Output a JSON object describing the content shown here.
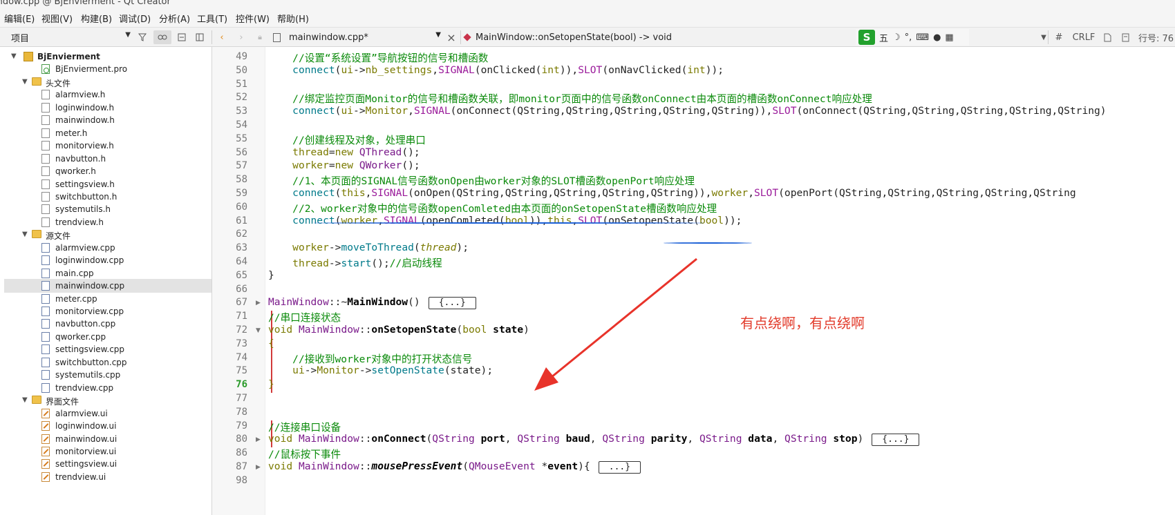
{
  "window": {
    "title": "indow.cpp @ BjEnvierment - Qt Creator"
  },
  "menu": [
    "编辑(E)",
    "视图(V)",
    "构建(B)",
    "调试(D)",
    "分析(A)",
    "工具(T)",
    "控件(W)",
    "帮助(H)"
  ],
  "toolbar": {
    "project_combo": "项目",
    "file_combo": "mainwindow.cpp*",
    "function_combo": "MainWindow::onSetopenState(bool) -> void",
    "ime_glyph": "五",
    "line_ending": "CRLF",
    "hash": "#",
    "position": "行号: 76"
  },
  "tree": [
    {
      "label": "BjEnvierment",
      "kind": "project",
      "indent": 0,
      "expanded": true,
      "bold": true
    },
    {
      "label": "BjEnvierment.pro",
      "kind": "pro",
      "indent": 2
    },
    {
      "label": "头文件",
      "kind": "folder",
      "indent": 1,
      "expanded": true
    },
    {
      "label": "alarmview.h",
      "kind": "h",
      "indent": 2
    },
    {
      "label": "loginwindow.h",
      "kind": "h",
      "indent": 2
    },
    {
      "label": "mainwindow.h",
      "kind": "h",
      "indent": 2
    },
    {
      "label": "meter.h",
      "kind": "h",
      "indent": 2
    },
    {
      "label": "monitorview.h",
      "kind": "h",
      "indent": 2
    },
    {
      "label": "navbutton.h",
      "kind": "h",
      "indent": 2
    },
    {
      "label": "qworker.h",
      "kind": "h",
      "indent": 2
    },
    {
      "label": "settingsview.h",
      "kind": "h",
      "indent": 2
    },
    {
      "label": "switchbutton.h",
      "kind": "h",
      "indent": 2
    },
    {
      "label": "systemutils.h",
      "kind": "h",
      "indent": 2
    },
    {
      "label": "trendview.h",
      "kind": "h",
      "indent": 2
    },
    {
      "label": "源文件",
      "kind": "folder",
      "indent": 1,
      "expanded": true
    },
    {
      "label": "alarmview.cpp",
      "kind": "cpp",
      "indent": 2
    },
    {
      "label": "loginwindow.cpp",
      "kind": "cpp",
      "indent": 2
    },
    {
      "label": "main.cpp",
      "kind": "cpp",
      "indent": 2
    },
    {
      "label": "mainwindow.cpp",
      "kind": "cpp",
      "indent": 2,
      "selected": true
    },
    {
      "label": "meter.cpp",
      "kind": "cpp",
      "indent": 2
    },
    {
      "label": "monitorview.cpp",
      "kind": "cpp",
      "indent": 2
    },
    {
      "label": "navbutton.cpp",
      "kind": "cpp",
      "indent": 2
    },
    {
      "label": "qworker.cpp",
      "kind": "cpp",
      "indent": 2
    },
    {
      "label": "settingsview.cpp",
      "kind": "cpp",
      "indent": 2
    },
    {
      "label": "switchbutton.cpp",
      "kind": "cpp",
      "indent": 2
    },
    {
      "label": "systemutils.cpp",
      "kind": "cpp",
      "indent": 2
    },
    {
      "label": "trendview.cpp",
      "kind": "cpp",
      "indent": 2
    },
    {
      "label": "界面文件",
      "kind": "uifolder",
      "indent": 1,
      "expanded": true
    },
    {
      "label": "alarmview.ui",
      "kind": "ui",
      "indent": 2
    },
    {
      "label": "loginwindow.ui",
      "kind": "ui",
      "indent": 2
    },
    {
      "label": "mainwindow.ui",
      "kind": "ui",
      "indent": 2
    },
    {
      "label": "monitorview.ui",
      "kind": "ui",
      "indent": 2
    },
    {
      "label": "settingsview.ui",
      "kind": "ui",
      "indent": 2
    },
    {
      "label": "trendview.ui",
      "kind": "ui",
      "indent": 2
    }
  ],
  "code_lines": [
    {
      "n": "49",
      "segs": [
        [
          "    ",
          ""
        ],
        [
          "//设置“系统设置”导航按钮的信号和槽函数",
          "cm"
        ]
      ]
    },
    {
      "n": "50",
      "segs": [
        [
          "    ",
          ""
        ],
        [
          "connect",
          "fn"
        ],
        [
          "(",
          ""
        ],
        [
          "ui",
          "kw"
        ],
        [
          "->",
          ""
        ],
        [
          "nb_settings",
          "kw"
        ],
        [
          ",",
          ""
        ],
        [
          "SIGNAL",
          "mc"
        ],
        [
          "(onClicked(",
          ""
        ],
        [
          "int",
          "kw"
        ],
        [
          "))",
          ""
        ],
        [
          ",",
          ""
        ],
        [
          "SLOT",
          "mc"
        ],
        [
          "(onNavClicked(",
          ""
        ],
        [
          "int",
          "kw"
        ],
        [
          "));",
          ""
        ]
      ]
    },
    {
      "n": "51",
      "segs": []
    },
    {
      "n": "52",
      "segs": [
        [
          "    ",
          ""
        ],
        [
          "//绑定监控页面Monitor的信号和槽函数关联，即monitor页面中的信号函数onConnect由本页面的槽函数onConnect响应处理",
          "cm"
        ]
      ]
    },
    {
      "n": "53",
      "segs": [
        [
          "    ",
          ""
        ],
        [
          "connect",
          "fn"
        ],
        [
          "(",
          ""
        ],
        [
          "ui",
          "kw"
        ],
        [
          "->",
          ""
        ],
        [
          "Monitor",
          "kw"
        ],
        [
          ",",
          ""
        ],
        [
          "SIGNAL",
          "mc"
        ],
        [
          "(onConnect(QString,QString,QString,QString,QString))",
          ""
        ],
        [
          ",",
          ""
        ],
        [
          "SLOT",
          "mc"
        ],
        [
          "(onConnect(QString,QString,QString,QString,QString)",
          ""
        ]
      ]
    },
    {
      "n": "54",
      "segs": []
    },
    {
      "n": "55",
      "segs": [
        [
          "    ",
          ""
        ],
        [
          "//创建线程及对象，处理串口",
          "cm"
        ]
      ]
    },
    {
      "n": "56",
      "segs": [
        [
          "    ",
          ""
        ],
        [
          "thread",
          "kw"
        ],
        [
          "=",
          ""
        ],
        [
          "new",
          "kw"
        ],
        [
          " ",
          ""
        ],
        [
          "QThread",
          "ty"
        ],
        [
          "();",
          ""
        ]
      ]
    },
    {
      "n": "57",
      "segs": [
        [
          "    ",
          ""
        ],
        [
          "worker",
          "kw"
        ],
        [
          "=",
          ""
        ],
        [
          "new",
          "kw"
        ],
        [
          " ",
          ""
        ],
        [
          "QWorker",
          "ty"
        ],
        [
          "();",
          ""
        ]
      ]
    },
    {
      "n": "58",
      "segs": [
        [
          "    ",
          ""
        ],
        [
          "//1、本页面的SIGNAL信号函数onOpen由worker对象的SLOT槽函数openPort响应处理",
          "cm"
        ]
      ]
    },
    {
      "n": "59",
      "segs": [
        [
          "    ",
          ""
        ],
        [
          "connect",
          "fn"
        ],
        [
          "(",
          ""
        ],
        [
          "this",
          "kw"
        ],
        [
          ",",
          ""
        ],
        [
          "SIGNAL",
          "mc"
        ],
        [
          "(onOpen(QString,QString,QString,QString,QString))",
          ""
        ],
        [
          ",",
          ""
        ],
        [
          "worker",
          "kw"
        ],
        [
          ",",
          ""
        ],
        [
          "SLOT",
          "mc"
        ],
        [
          "(openPort(QString,QString,QString,QString,QString",
          ""
        ]
      ]
    },
    {
      "n": "60",
      "segs": [
        [
          "    ",
          ""
        ],
        [
          "//2、worker对象中的信号函数openComleted由本页面的onSetopenState槽函数响应处理",
          "cm"
        ]
      ]
    },
    {
      "n": "61",
      "segs": [
        [
          "    ",
          ""
        ],
        [
          "connect",
          "fn"
        ],
        [
          "(",
          ""
        ],
        [
          "worker",
          "kw"
        ],
        [
          ",",
          ""
        ],
        [
          "SIGNAL",
          "mc"
        ],
        [
          "(openComleted(",
          ""
        ],
        [
          "bool",
          "kw"
        ],
        [
          "))",
          ""
        ],
        [
          ",",
          ""
        ],
        [
          "this",
          "kw"
        ],
        [
          ",",
          ""
        ],
        [
          "SLOT",
          "mc"
        ],
        [
          "(onSetopenState(",
          ""
        ],
        [
          "bool",
          "kw"
        ],
        [
          "));",
          ""
        ]
      ]
    },
    {
      "n": "62",
      "segs": []
    },
    {
      "n": "63",
      "segs": [
        [
          "    ",
          ""
        ],
        [
          "worker",
          "kw"
        ],
        [
          "->",
          ""
        ],
        [
          "moveToThread",
          "fn"
        ],
        [
          "(",
          ""
        ],
        [
          "thread",
          "kw it"
        ],
        [
          ");",
          ""
        ]
      ]
    },
    {
      "n": "64",
      "segs": [
        [
          "    ",
          ""
        ],
        [
          "thread",
          "kw"
        ],
        [
          "->",
          ""
        ],
        [
          "start",
          "fn"
        ],
        [
          "();",
          ""
        ],
        [
          "//启动线程",
          "cm"
        ]
      ]
    },
    {
      "n": "65",
      "segs": [
        [
          "}",
          ""
        ]
      ]
    },
    {
      "n": "66",
      "segs": []
    },
    {
      "n": "67",
      "segs": [
        [
          "MainWindow",
          "ty"
        ],
        [
          "::~",
          ""
        ],
        [
          "MainWindow",
          "pm fn"
        ],
        [
          "()",
          ""
        ]
      ],
      "fold": "▶",
      "box": "{...}"
    },
    {
      "n": "71",
      "segs": [
        [
          "//串口连接状态",
          "cm"
        ]
      ]
    },
    {
      "n": "72",
      "segs": [
        [
          "void",
          "kw"
        ],
        [
          " ",
          ""
        ],
        [
          "MainWindow",
          "ty"
        ],
        [
          "::",
          ""
        ],
        [
          "onSetopenState",
          "pm fn"
        ],
        [
          "(",
          ""
        ],
        [
          "bool",
          "kw"
        ],
        [
          " ",
          ""
        ],
        [
          "state",
          "pm"
        ],
        [
          ")",
          ""
        ]
      ],
      "fold": "▼"
    },
    {
      "n": "73",
      "segs": [
        [
          "{",
          "kw"
        ]
      ]
    },
    {
      "n": "74",
      "segs": [
        [
          "    ",
          ""
        ],
        [
          "//接收到worker对象中的打开状态信号",
          "cm"
        ]
      ]
    },
    {
      "n": "75",
      "segs": [
        [
          "    ",
          ""
        ],
        [
          "ui",
          "kw"
        ],
        [
          "->",
          ""
        ],
        [
          "Monitor",
          "kw"
        ],
        [
          "->",
          ""
        ],
        [
          "setOpenState",
          "fn"
        ],
        [
          "(state);",
          ""
        ]
      ]
    },
    {
      "n": "76",
      "segs": [
        [
          "}",
          "kw"
        ]
      ],
      "current": true
    },
    {
      "n": "77",
      "segs": []
    },
    {
      "n": "78",
      "segs": []
    },
    {
      "n": "79",
      "segs": [
        [
          "//连接串口设备",
          "cm"
        ]
      ]
    },
    {
      "n": "80",
      "segs": [
        [
          "void",
          "kw"
        ],
        [
          " ",
          ""
        ],
        [
          "MainWindow",
          "ty"
        ],
        [
          "::",
          ""
        ],
        [
          "onConnect",
          "pm fn"
        ],
        [
          "(",
          ""
        ],
        [
          "QString",
          "ty"
        ],
        [
          " ",
          ""
        ],
        [
          "port",
          "pm"
        ],
        [
          ", ",
          ""
        ],
        [
          "QString",
          "ty"
        ],
        [
          " ",
          ""
        ],
        [
          "baud",
          "pm"
        ],
        [
          ", ",
          ""
        ],
        [
          "QString",
          "ty"
        ],
        [
          " ",
          ""
        ],
        [
          "parity",
          "pm"
        ],
        [
          ", ",
          ""
        ],
        [
          "QString",
          "ty"
        ],
        [
          " ",
          ""
        ],
        [
          "data",
          "pm"
        ],
        [
          ", ",
          ""
        ],
        [
          "QString",
          "ty"
        ],
        [
          " ",
          ""
        ],
        [
          "stop",
          "pm"
        ],
        [
          ")",
          ""
        ]
      ],
      "fold": "▶",
      "box": "{...}"
    },
    {
      "n": "86",
      "segs": [
        [
          "//鼠标按下事件",
          "cm"
        ]
      ]
    },
    {
      "n": "87",
      "segs": [
        [
          "void",
          "kw"
        ],
        [
          " ",
          ""
        ],
        [
          "MainWindow",
          "ty"
        ],
        [
          "::",
          ""
        ],
        [
          "mousePressEvent",
          "pm fn it"
        ],
        [
          "(",
          ""
        ],
        [
          "QMouseEvent",
          "ty"
        ],
        [
          " *",
          ""
        ],
        [
          "event",
          "pm"
        ],
        [
          "){",
          ""
        ]
      ],
      "fold": "▶",
      "box": "...}"
    },
    {
      "n": "98",
      "segs": []
    }
  ],
  "annotation": "有点绕啊，有点绕啊"
}
